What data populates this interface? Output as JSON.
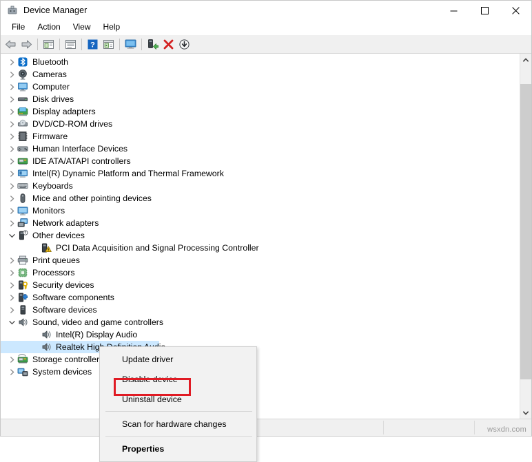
{
  "window": {
    "title": "Device Manager",
    "app_icon": "device-manager-icon",
    "controls": {
      "minimize": "minimize-icon",
      "maximize": "maximize-icon",
      "close": "close-icon"
    }
  },
  "menubar": {
    "items": [
      {
        "label": "File"
      },
      {
        "label": "Action"
      },
      {
        "label": "View"
      },
      {
        "label": "Help"
      }
    ]
  },
  "toolbar": {
    "buttons": [
      {
        "name": "back-button",
        "icon": "arrow-left-icon"
      },
      {
        "name": "forward-button",
        "icon": "arrow-right-icon"
      },
      {
        "name": "separator-1",
        "icon": "separator"
      },
      {
        "name": "show-hide-console-tree-button",
        "icon": "console-tree-icon"
      },
      {
        "name": "separator-2",
        "icon": "separator"
      },
      {
        "name": "properties-button",
        "icon": "properties-icon"
      },
      {
        "name": "separator-3",
        "icon": "separator"
      },
      {
        "name": "help-button",
        "icon": "help-icon"
      },
      {
        "name": "show-window-in-task-button",
        "icon": "window-task-icon"
      },
      {
        "name": "separator-4",
        "icon": "separator"
      },
      {
        "name": "scan-hardware-changes-button",
        "icon": "scan-monitor-icon"
      },
      {
        "name": "separator-5",
        "icon": "separator"
      },
      {
        "name": "update-driver-button",
        "icon": "update-driver-icon"
      },
      {
        "name": "uninstall-device-button",
        "icon": "red-x-icon"
      },
      {
        "name": "disable-device-button",
        "icon": "disable-device-icon"
      }
    ]
  },
  "tree": {
    "rows": [
      {
        "label": "Bluetooth",
        "icon": "bluetooth-icon",
        "level": 1,
        "expander": "collapsed",
        "selected": false
      },
      {
        "label": "Cameras",
        "icon": "camera-icon",
        "level": 1,
        "expander": "collapsed",
        "selected": false
      },
      {
        "label": "Computer",
        "icon": "computer-icon",
        "level": 1,
        "expander": "collapsed",
        "selected": false
      },
      {
        "label": "Disk drives",
        "icon": "disk-drive-icon",
        "level": 1,
        "expander": "collapsed",
        "selected": false
      },
      {
        "label": "Display adapters",
        "icon": "display-adapter-icon",
        "level": 1,
        "expander": "collapsed",
        "selected": false
      },
      {
        "label": "DVD/CD-ROM drives",
        "icon": "dvd-drive-icon",
        "level": 1,
        "expander": "collapsed",
        "selected": false
      },
      {
        "label": "Firmware",
        "icon": "firmware-icon",
        "level": 1,
        "expander": "collapsed",
        "selected": false
      },
      {
        "label": "Human Interface Devices",
        "icon": "hid-icon",
        "level": 1,
        "expander": "collapsed",
        "selected": false
      },
      {
        "label": "IDE ATA/ATAPI controllers",
        "icon": "ide-controller-icon",
        "level": 1,
        "expander": "collapsed",
        "selected": false
      },
      {
        "label": "Intel(R) Dynamic Platform and Thermal Framework",
        "icon": "thermal-framework-icon",
        "level": 1,
        "expander": "collapsed",
        "selected": false
      },
      {
        "label": "Keyboards",
        "icon": "keyboard-icon",
        "level": 1,
        "expander": "collapsed",
        "selected": false
      },
      {
        "label": "Mice and other pointing devices",
        "icon": "mouse-icon",
        "level": 1,
        "expander": "collapsed",
        "selected": false
      },
      {
        "label": "Monitors",
        "icon": "monitor-icon",
        "level": 1,
        "expander": "collapsed",
        "selected": false
      },
      {
        "label": "Network adapters",
        "icon": "network-adapter-icon",
        "level": 1,
        "expander": "collapsed",
        "selected": false
      },
      {
        "label": "Other devices",
        "icon": "other-device-icon",
        "level": 1,
        "expander": "expanded",
        "selected": false
      },
      {
        "label": "PCI Data Acquisition and Signal Processing Controller",
        "icon": "warning-device-icon",
        "level": 2,
        "expander": "none",
        "selected": false
      },
      {
        "label": "Print queues",
        "icon": "printer-icon",
        "level": 1,
        "expander": "collapsed",
        "selected": false
      },
      {
        "label": "Processors",
        "icon": "processor-icon",
        "level": 1,
        "expander": "collapsed",
        "selected": false
      },
      {
        "label": "Security devices",
        "icon": "security-device-icon",
        "level": 1,
        "expander": "collapsed",
        "selected": false
      },
      {
        "label": "Software components",
        "icon": "software-component-icon",
        "level": 1,
        "expander": "collapsed",
        "selected": false
      },
      {
        "label": "Software devices",
        "icon": "software-device-icon",
        "level": 1,
        "expander": "collapsed",
        "selected": false
      },
      {
        "label": "Sound, video and game controllers",
        "icon": "speaker-icon",
        "level": 1,
        "expander": "expanded",
        "selected": false
      },
      {
        "label": "Intel(R) Display Audio",
        "icon": "speaker-icon",
        "level": 2,
        "expander": "none",
        "selected": false
      },
      {
        "label": "Realtek High Definition Audio",
        "icon": "speaker-icon",
        "level": 2,
        "expander": "none",
        "selected": true
      },
      {
        "label": "Storage controllers",
        "icon": "storage-controller-icon",
        "level": 1,
        "expander": "collapsed",
        "selected": false
      },
      {
        "label": "System devices",
        "icon": "system-device-icon",
        "level": 1,
        "expander": "collapsed",
        "selected": false
      }
    ]
  },
  "scrollbar": {
    "up_arrow": "chevron-up-icon",
    "down_arrow": "chevron-down-icon"
  },
  "context_menu": {
    "items": [
      {
        "label": "Update driver",
        "bold": false,
        "separator_after": false
      },
      {
        "label": "Disable device",
        "bold": false,
        "separator_after": false
      },
      {
        "label": "Uninstall device",
        "bold": false,
        "separator_after": true
      },
      {
        "label": "Scan for hardware changes",
        "bold": false,
        "separator_after": true
      },
      {
        "label": "Properties",
        "bold": true,
        "separator_after": false
      }
    ]
  },
  "annotation": {
    "target_label": "Uninstall device",
    "color": "#e01b24"
  },
  "statusbar": {
    "panels": [
      "",
      "",
      ""
    ]
  },
  "watermark": {
    "text": "wsxdn.com"
  },
  "colors": {
    "selection": "#cce8ff",
    "toolbar_bg": "#f0f0f0",
    "menu_bg": "#f2f2f2",
    "annotation_red": "#e01b24",
    "bluetooth_blue": "#0b6ec9"
  }
}
